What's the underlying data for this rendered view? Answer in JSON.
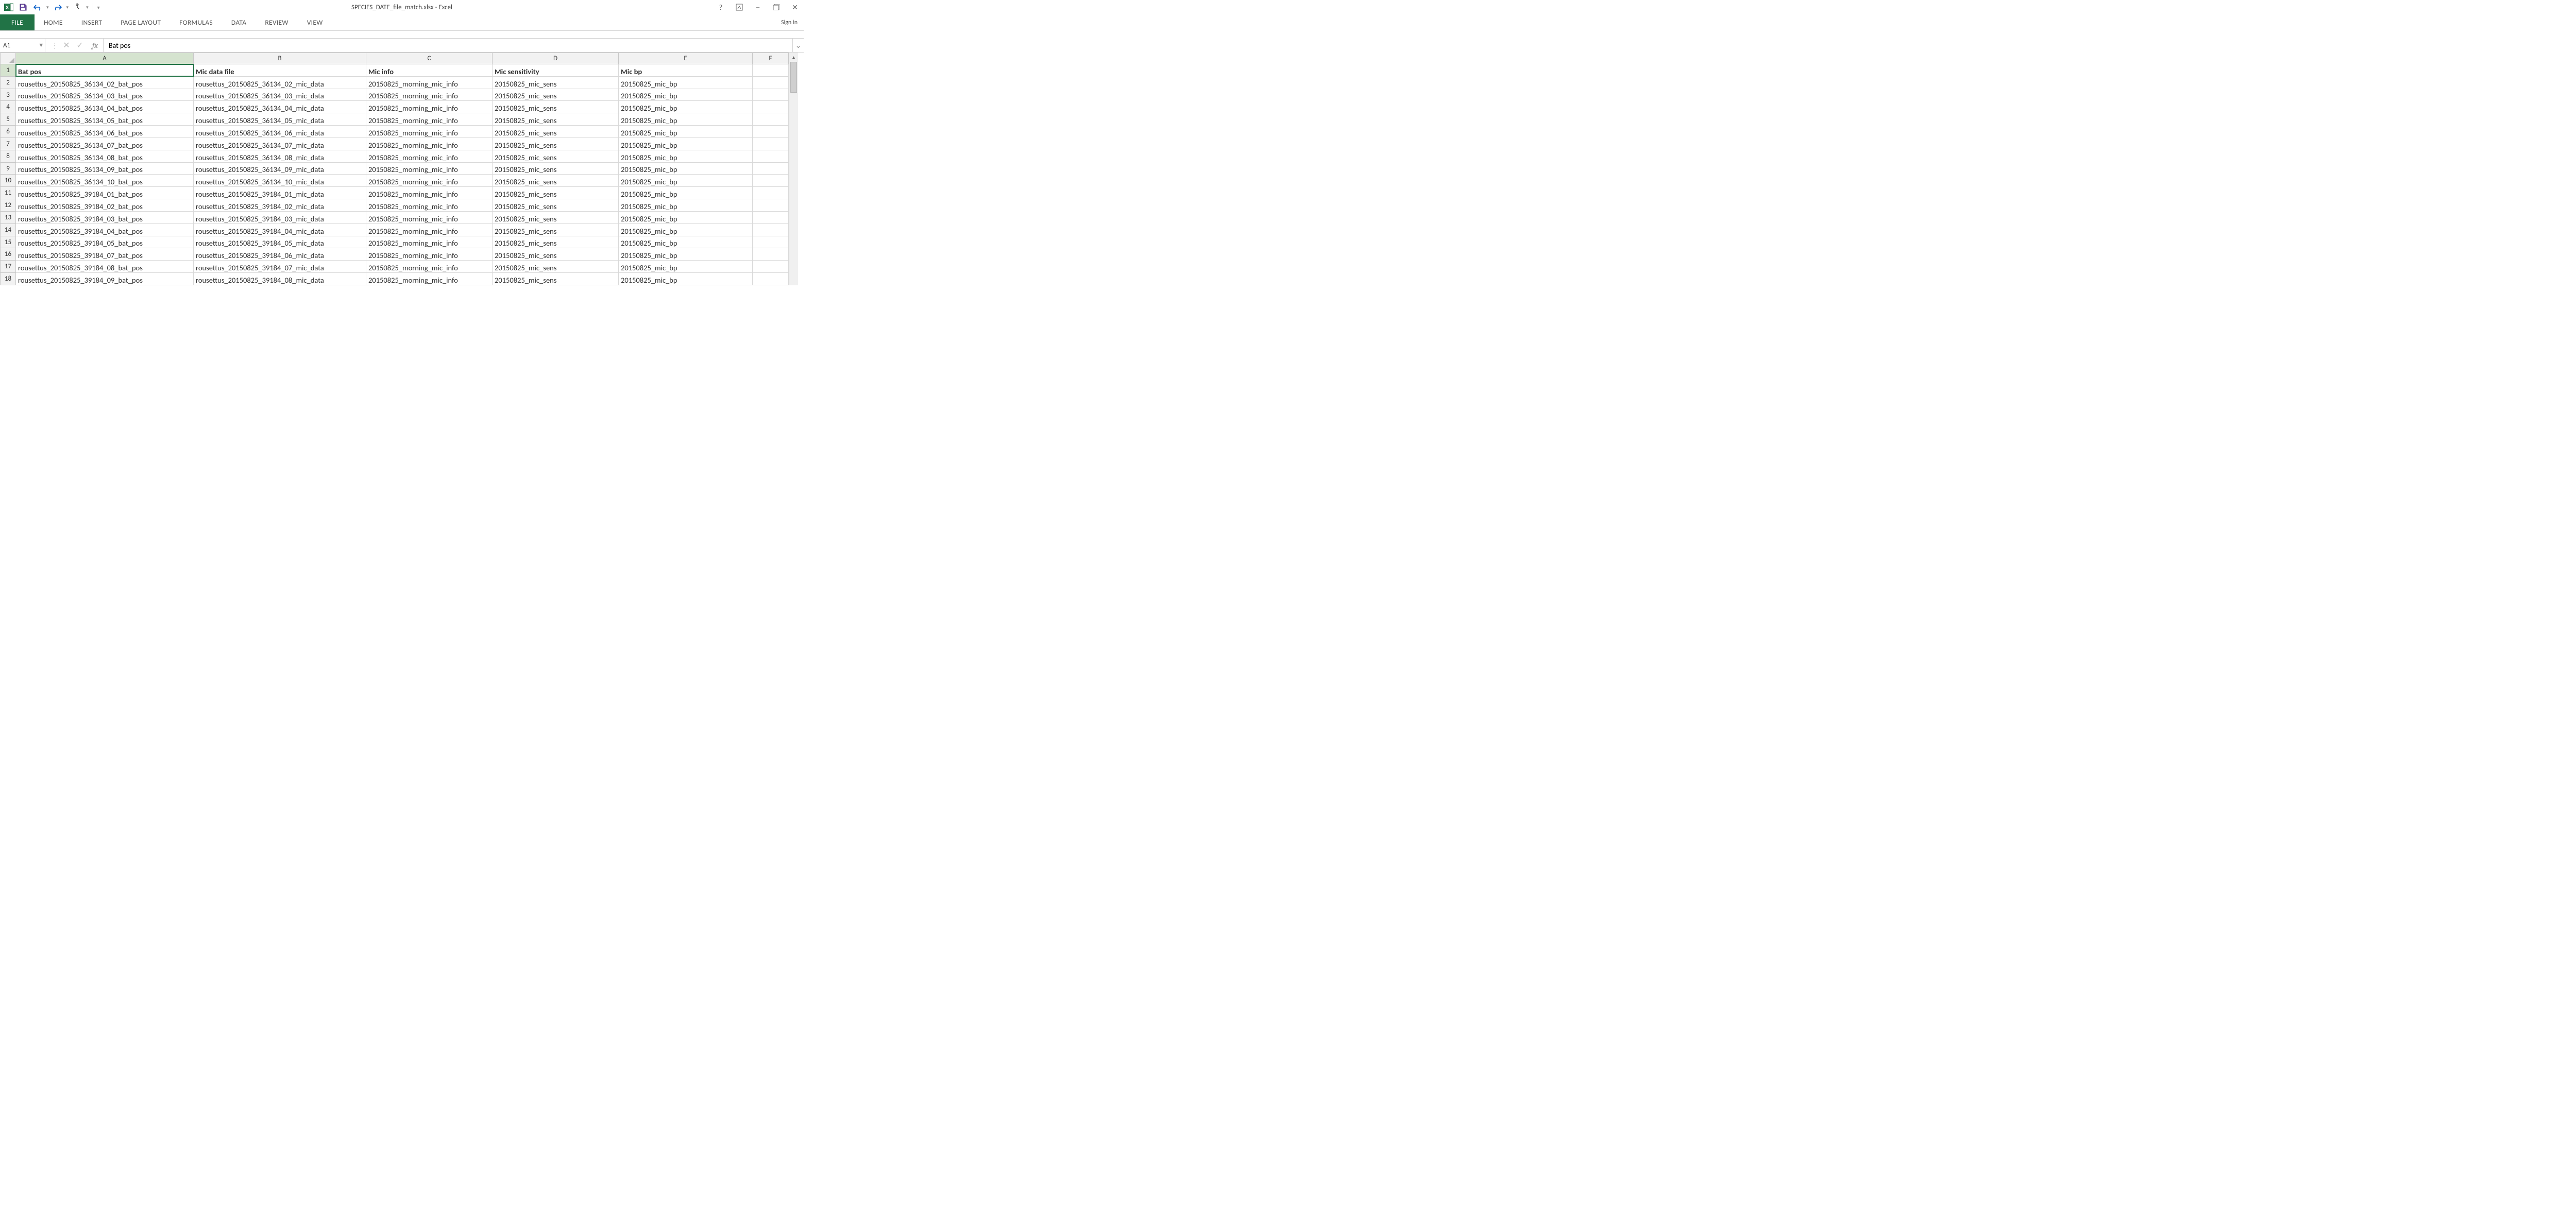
{
  "window": {
    "title": "SPECIES_DATE_file_match.xlsx - Excel"
  },
  "qat": {
    "excel_icon": "X",
    "save": "save",
    "undo": "undo",
    "redo": "redo",
    "touch": "touch-mouse-mode",
    "customize": "▾"
  },
  "window_controls": {
    "help": "?",
    "ribbon_options": "⎘",
    "minimize": "–",
    "restore": "▢",
    "close": "✕"
  },
  "ribbon": {
    "tabs": [
      "FILE",
      "HOME",
      "INSERT",
      "PAGE LAYOUT",
      "FORMULAS",
      "DATA",
      "REVIEW",
      "VIEW"
    ],
    "signin": "Sign in"
  },
  "formula_bar": {
    "name_box": "A1",
    "cancel": "✕",
    "enter": "✓",
    "fx": "fx",
    "formula": "Bat pos",
    "expand": "⌄"
  },
  "grid": {
    "columns": [
      "A",
      "B",
      "C",
      "D",
      "E",
      "F"
    ],
    "col_widths": {
      "A": 345,
      "B": 335,
      "C": 245,
      "D": 245,
      "E": 260,
      "F": 70
    },
    "headers": {
      "A": "Bat pos",
      "B": "Mic data file",
      "C": "Mic info",
      "D": "Mic sensitivity",
      "E": "Mic bp"
    },
    "rows": [
      {
        "n": 2,
        "A": "rousettus_20150825_36134_02_bat_pos",
        "B": "rousettus_20150825_36134_02_mic_data",
        "C": "20150825_morning_mic_info",
        "D": "20150825_mic_sens",
        "E": "20150825_mic_bp"
      },
      {
        "n": 3,
        "A": "rousettus_20150825_36134_03_bat_pos",
        "B": "rousettus_20150825_36134_03_mic_data",
        "C": "20150825_morning_mic_info",
        "D": "20150825_mic_sens",
        "E": "20150825_mic_bp"
      },
      {
        "n": 4,
        "A": "rousettus_20150825_36134_04_bat_pos",
        "B": "rousettus_20150825_36134_04_mic_data",
        "C": "20150825_morning_mic_info",
        "D": "20150825_mic_sens",
        "E": "20150825_mic_bp"
      },
      {
        "n": 5,
        "A": "rousettus_20150825_36134_05_bat_pos",
        "B": "rousettus_20150825_36134_05_mic_data",
        "C": "20150825_morning_mic_info",
        "D": "20150825_mic_sens",
        "E": "20150825_mic_bp"
      },
      {
        "n": 6,
        "A": "rousettus_20150825_36134_06_bat_pos",
        "B": "rousettus_20150825_36134_06_mic_data",
        "C": "20150825_morning_mic_info",
        "D": "20150825_mic_sens",
        "E": "20150825_mic_bp"
      },
      {
        "n": 7,
        "A": "rousettus_20150825_36134_07_bat_pos",
        "B": "rousettus_20150825_36134_07_mic_data",
        "C": "20150825_morning_mic_info",
        "D": "20150825_mic_sens",
        "E": "20150825_mic_bp"
      },
      {
        "n": 8,
        "A": "rousettus_20150825_36134_08_bat_pos",
        "B": "rousettus_20150825_36134_08_mic_data",
        "C": "20150825_morning_mic_info",
        "D": "20150825_mic_sens",
        "E": "20150825_mic_bp"
      },
      {
        "n": 9,
        "A": "rousettus_20150825_36134_09_bat_pos",
        "B": "rousettus_20150825_36134_09_mic_data",
        "C": "20150825_morning_mic_info",
        "D": "20150825_mic_sens",
        "E": "20150825_mic_bp"
      },
      {
        "n": 10,
        "A": "rousettus_20150825_36134_10_bat_pos",
        "B": "rousettus_20150825_36134_10_mic_data",
        "C": "20150825_morning_mic_info",
        "D": "20150825_mic_sens",
        "E": "20150825_mic_bp"
      },
      {
        "n": 11,
        "A": "rousettus_20150825_39184_01_bat_pos",
        "B": "rousettus_20150825_39184_01_mic_data",
        "C": "20150825_morning_mic_info",
        "D": "20150825_mic_sens",
        "E": "20150825_mic_bp"
      },
      {
        "n": 12,
        "A": "rousettus_20150825_39184_02_bat_pos",
        "B": "rousettus_20150825_39184_02_mic_data",
        "C": "20150825_morning_mic_info",
        "D": "20150825_mic_sens",
        "E": "20150825_mic_bp"
      },
      {
        "n": 13,
        "A": "rousettus_20150825_39184_03_bat_pos",
        "B": "rousettus_20150825_39184_03_mic_data",
        "C": "20150825_morning_mic_info",
        "D": "20150825_mic_sens",
        "E": "20150825_mic_bp"
      },
      {
        "n": 14,
        "A": "rousettus_20150825_39184_04_bat_pos",
        "B": "rousettus_20150825_39184_04_mic_data",
        "C": "20150825_morning_mic_info",
        "D": "20150825_mic_sens",
        "E": "20150825_mic_bp"
      },
      {
        "n": 15,
        "A": "rousettus_20150825_39184_05_bat_pos",
        "B": "rousettus_20150825_39184_05_mic_data",
        "C": "20150825_morning_mic_info",
        "D": "20150825_mic_sens",
        "E": "20150825_mic_bp"
      },
      {
        "n": 16,
        "A": "rousettus_20150825_39184_07_bat_pos",
        "B": "rousettus_20150825_39184_06_mic_data",
        "C": "20150825_morning_mic_info",
        "D": "20150825_mic_sens",
        "E": "20150825_mic_bp"
      },
      {
        "n": 17,
        "A": "rousettus_20150825_39184_08_bat_pos",
        "B": "rousettus_20150825_39184_07_mic_data",
        "C": "20150825_morning_mic_info",
        "D": "20150825_mic_sens",
        "E": "20150825_mic_bp"
      },
      {
        "n": 18,
        "A": "rousettus_20150825_39184_09_bat_pos",
        "B": "rousettus_20150825_39184_08_mic_data",
        "C": "20150825_morning_mic_info",
        "D": "20150825_mic_sens",
        "E": "20150825_mic_bp"
      }
    ]
  }
}
